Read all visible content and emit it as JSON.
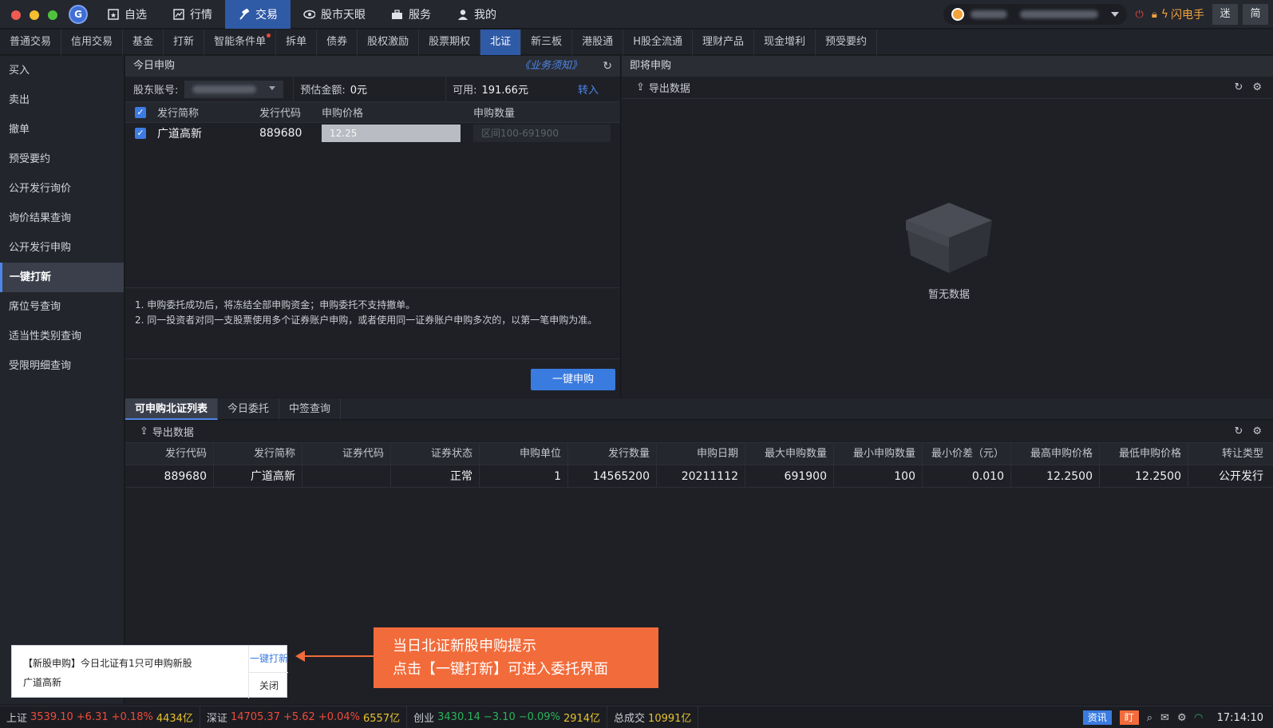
{
  "topnav": [
    {
      "label": "自选",
      "icon": "star-icon"
    },
    {
      "label": "行情",
      "icon": "chart-icon"
    },
    {
      "label": "交易",
      "icon": "hammer-icon"
    },
    {
      "label": "股市天眼",
      "icon": "eye-icon"
    },
    {
      "label": "服务",
      "icon": "briefcase-icon"
    },
    {
      "label": "我的",
      "icon": "user-icon"
    }
  ],
  "topright": {
    "flash_label": "闪电手",
    "btn_mi": "迷",
    "btn_jian": "简"
  },
  "subtabs": [
    "普通交易",
    "信用交易",
    "基金",
    "打新",
    "智能条件单",
    "拆单",
    "债券",
    "股权激励",
    "股票期权",
    "北证",
    "新三板",
    "港股通",
    "H股全流通",
    "理财产品",
    "现金增利",
    "预受要约"
  ],
  "sidebar": [
    "买入",
    "卖出",
    "撤单",
    "预受要约",
    "公开发行询价",
    "询价结果查询",
    "公开发行申购",
    "一键打新",
    "席位号查询",
    "适当性类别查询",
    "受限明细查询"
  ],
  "today": {
    "title": "今日申购",
    "notice_link": "《业务须知》",
    "account_label": "股东账号:",
    "est_label": "预估金额:",
    "est_value": "0元",
    "avail_label": "可用:",
    "avail_value": "191.66元",
    "transfer": "转入",
    "headers": [
      "发行简称",
      "发行代码",
      "申购价格",
      "申购数量"
    ],
    "row": {
      "name": "广道高新",
      "code": "889680",
      "price": "12.25",
      "qty_placeholder": "区间100-691900"
    },
    "note1": "1. 申购委托成功后，将冻结全部申购资金；申购委托不支持撤单。",
    "note2": "2. 同一投资者对同一支股票使用多个证券账户申购，或者使用同一证券账户申购多次的，以第一笔申购为准。",
    "submit": "一键申购"
  },
  "upcoming": {
    "title": "即将申购",
    "export": "导出数据",
    "empty": "暂无数据"
  },
  "bottom_tabs": [
    "可申购北证列表",
    "今日委托",
    "中签查询"
  ],
  "grid": {
    "export": "导出数据",
    "headers": [
      "发行代码",
      "发行简称",
      "证券代码",
      "证券状态",
      "申购单位",
      "发行数量",
      "申购日期",
      "最大申购数量",
      "最小申购数量",
      "最小价差（元）",
      "最高申购价格",
      "最低申购价格",
      "转让类型"
    ],
    "rows": [
      [
        "889680",
        "广道高新",
        "",
        "正常",
        "1",
        "14565200",
        "20211112",
        "691900",
        "100",
        "0.010",
        "12.2500",
        "12.2500",
        "公开发行"
      ]
    ]
  },
  "popup": {
    "msg1": "【新股申购】今日北证有1只可申购新股",
    "msg2": "广道高新",
    "action": "一键打新",
    "close": "关闭"
  },
  "callout": {
    "line1": "当日北证新股申购提示",
    "line2": "点击【一键打新】可进入委托界面"
  },
  "status": {
    "sh": {
      "name": "上证",
      "price": "3539.10",
      "chg": "+6.31",
      "pct": "+0.18%",
      "vol": "4434亿"
    },
    "sz": {
      "name": "深证",
      "price": "14705.37",
      "chg": "+5.62",
      "pct": "+0.04%",
      "vol": "6557亿"
    },
    "cy": {
      "name": "创业",
      "price": "3430.14",
      "chg": "−3.10",
      "pct": "−0.09%",
      "vol": "2914亿"
    },
    "total_label": "总成交",
    "total": "10991亿",
    "news": "资讯",
    "ding": "盯",
    "time": "17:14:10"
  }
}
